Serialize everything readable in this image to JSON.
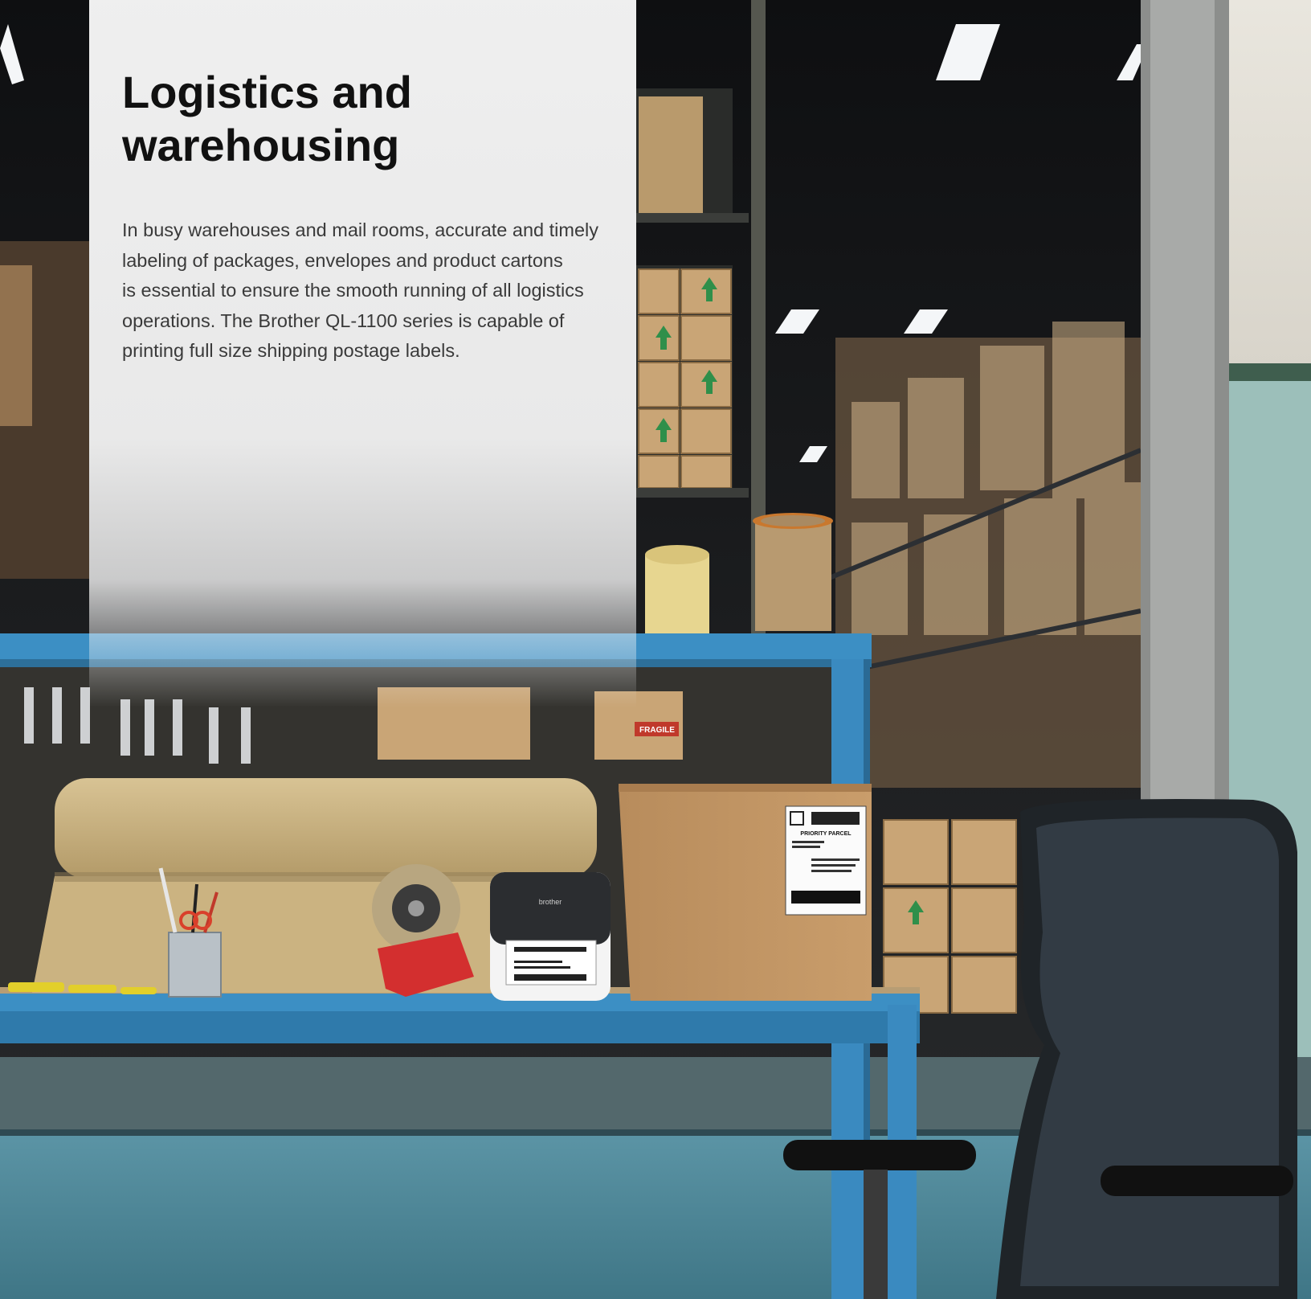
{
  "heading": "Logistics and\nwarehousing",
  "body": "In busy warehouses and mail rooms, accurate and timely\nlabeling of packages, envelopes and product cartons\nis essential to ensure the smooth running of all logistics\noperations. The Brother QL-1100 series is capable of\nprinting full size shipping postage labels.",
  "printer": {
    "brand": "brother"
  },
  "shipping_label": {
    "service": "PRIORITY PARCEL"
  },
  "box_sticker": "FRAGILE",
  "colors": {
    "workbench": "#3c8fc4",
    "warehouse_dark": "#16181b",
    "panel": "#f5f5f5",
    "heading": "#111111",
    "body_text": "#3a3a3a"
  }
}
